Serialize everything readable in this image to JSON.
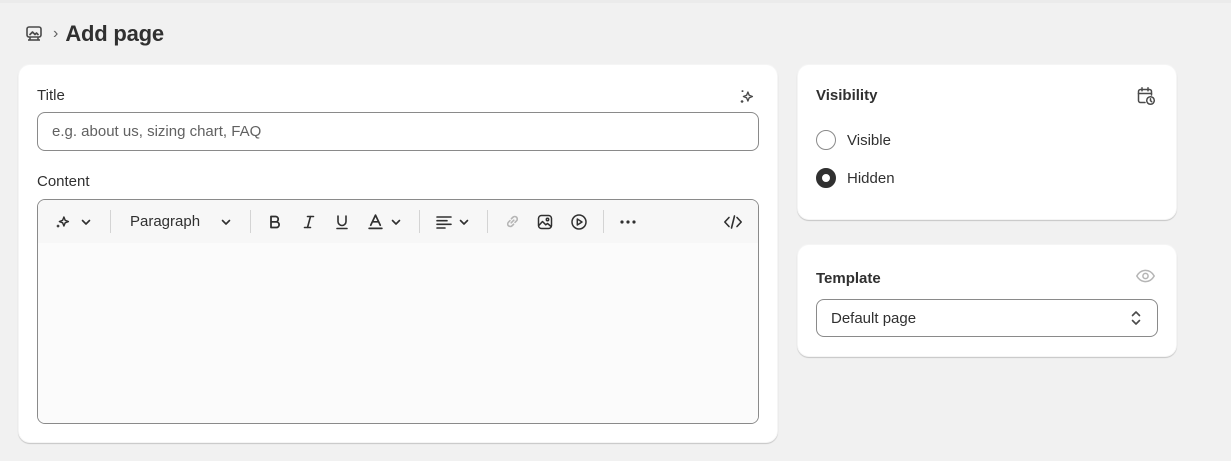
{
  "header": {
    "title": "Add page",
    "separator": "›",
    "icon": "pages-icon"
  },
  "main": {
    "title_label": "Title",
    "title_value": "",
    "title_placeholder": "e.g. about us, sizing chart, FAQ",
    "content_label": "Content",
    "toolbar": {
      "paragraph_label": "Paragraph",
      "icons": [
        "magic-icon",
        "chevron-down-icon",
        "bold-icon",
        "italic-icon",
        "underline-icon",
        "text-color-icon",
        "align-icon",
        "link-icon",
        "image-icon",
        "video-icon",
        "more-icon",
        "code-icon"
      ]
    }
  },
  "visibility": {
    "title": "Visibility",
    "options": [
      {
        "label": "Visible",
        "selected": false
      },
      {
        "label": "Hidden",
        "selected": true
      }
    ]
  },
  "template": {
    "title": "Template",
    "selected": "Default page"
  },
  "colors": {
    "background": "#f1f1f1",
    "card": "#ffffff",
    "text": "#303030",
    "border": "#8a8a8a",
    "muted_icon": "#b5b5b5"
  }
}
